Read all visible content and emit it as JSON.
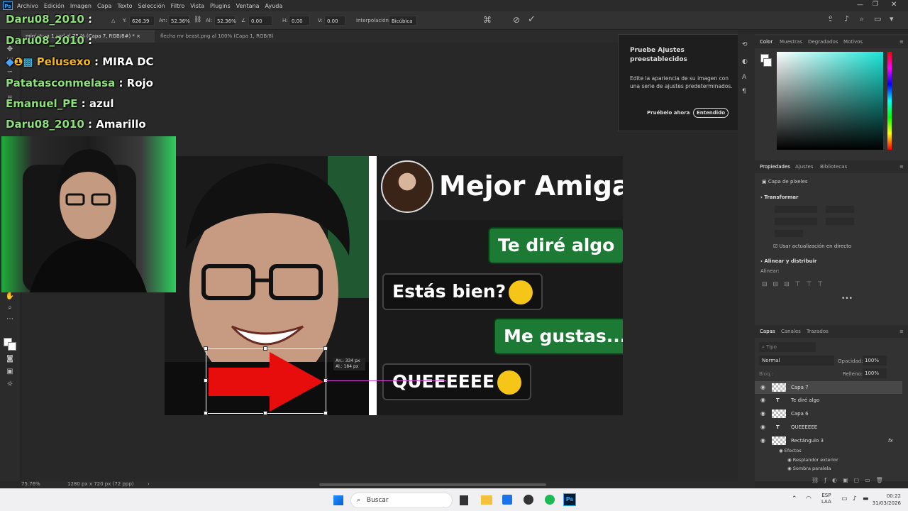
{
  "menubar": {
    "items": [
      "Archivo",
      "Edición",
      "Imagen",
      "Capa",
      "Texto",
      "Selección",
      "Filtro",
      "Vista",
      "Plugins",
      "Ventana",
      "Ayuda"
    ]
  },
  "optbar": {
    "y_value": "626.39 px",
    "an_label": "An:",
    "an_value": "52.36%",
    "al_label": "Al:",
    "al_value": "52.36%",
    "angle_value": "0.00",
    "h_label": "H:",
    "h_value": "0.00",
    "v_label": "V:",
    "v_value": "0.00",
    "interp_label": "Interpolación:",
    "interp_value": "Bicúbica"
  },
  "tabs": [
    {
      "label": "miniatura 1.psd al 75.% (Capa 7, RGB/8#) *"
    },
    {
      "label": "flecha mr beast.png al 100% (Capa 1, RGB/8)"
    }
  ],
  "chat": [
    {
      "user": "Daru08_2010",
      "msg": "",
      "color": "#8ee07a"
    },
    {
      "user": "Daru08_2010",
      "msg": "",
      "color": "#8ee07a"
    },
    {
      "user": "Pelusexo",
      "msg": "MIRA DC",
      "color": "#f2b51f"
    },
    {
      "user": "Patatasconmelasa",
      "msg": "Rojo",
      "color": "#8ee07a"
    },
    {
      "user": "Emanuel_PE",
      "msg": "azul",
      "color": "#8ee07a"
    },
    {
      "user": "Daru08_2010",
      "msg": "Amarillo",
      "color": "#8ee07a"
    }
  ],
  "thumbnail": {
    "title": "Mejor Amiga",
    "bubbles": [
      {
        "text": "Te diré algo",
        "style": "green"
      },
      {
        "text": "Estás bien?",
        "style": "black",
        "emoji": "thinking-emoji"
      },
      {
        "text": "Me gustas...",
        "style": "green"
      },
      {
        "text": "QUEEEEEE",
        "style": "black",
        "emoji": "flushed-emoji"
      }
    ],
    "transform_readout": {
      "an": "An.: 334 px",
      "al": "Al.: 184 px"
    }
  },
  "tooltip": {
    "title": "Pruebe Ajustes preestablecidos",
    "body": "Edite la apariencia de su imagen con una serie de ajustes predeterminados.",
    "try_label": "Pruébelo ahora",
    "ok_label": "Entendido"
  },
  "color_panel": {
    "tabs": [
      "Color",
      "Muestras",
      "Degradados",
      "Motivos"
    ],
    "hue_color": "#19e6d7"
  },
  "properties": {
    "tabs": [
      "Propiedades",
      "Ajustes",
      "Bibliotecas"
    ],
    "kind": "Capa de píxeles",
    "transform_label": "Transformar",
    "live_update_label": "Usar actualización en directo",
    "align_label": "Alinear y distribuir",
    "align_sub": "Alinear:"
  },
  "layers": {
    "tabs": [
      "Capas",
      "Canales",
      "Trazados"
    ],
    "search_placeholder": "Tipo",
    "blend_mode": "Normal",
    "opacity_label": "Opacidad:",
    "opacity_value": "100%",
    "fill_label": "Relleno:",
    "fill_value": "100%",
    "lock_label": "Bloq.:",
    "items": [
      {
        "name": "Capa 7",
        "kind": "pixel"
      },
      {
        "name": "Te diré algo",
        "kind": "text"
      },
      {
        "name": "Capa 6",
        "kind": "pixel"
      },
      {
        "name": "QUEEEEEE",
        "kind": "text"
      },
      {
        "name": "Rectángulo 3",
        "kind": "shape"
      }
    ],
    "effects_label": "Efectos",
    "effects": [
      "Resplandor exterior",
      "Sombra paralela"
    ]
  },
  "status": {
    "zoom": "75.76%",
    "doc_size": "1280 px x 720 px (72 ppp)"
  },
  "taskbar": {
    "search_label": "Buscar",
    "lang_top": "ESP",
    "lang_bottom": "LAA",
    "time": "00:22",
    "date": "31/03/2026"
  }
}
